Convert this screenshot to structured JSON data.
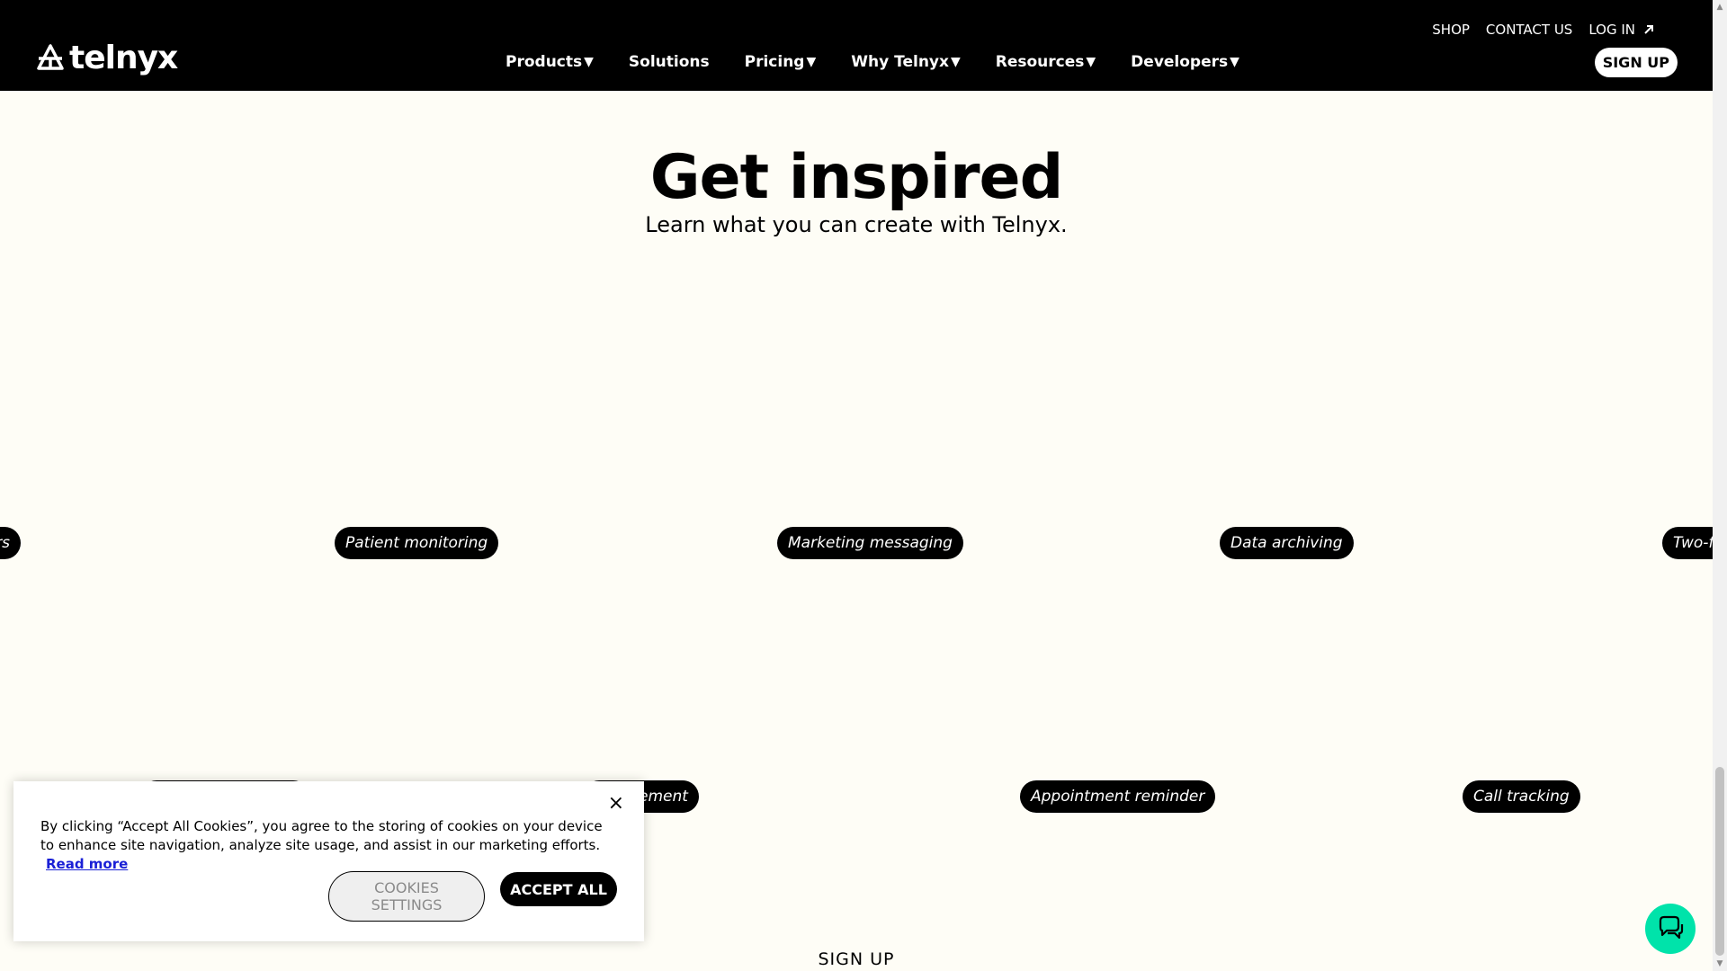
{
  "header": {
    "logo_text": "telnyx",
    "top_links": {
      "shop": "SHOP",
      "contact": "CONTACT US",
      "login": "LOG IN"
    },
    "nav": [
      {
        "label": "Products",
        "has_dropdown": true
      },
      {
        "label": "Solutions",
        "has_dropdown": false
      },
      {
        "label": "Pricing",
        "has_dropdown": true
      },
      {
        "label": "Why Telnyx",
        "has_dropdown": true
      },
      {
        "label": "Resources",
        "has_dropdown": true
      },
      {
        "label": "Developers",
        "has_dropdown": true
      }
    ],
    "dropdown_glyph": "▼",
    "signup": "SIGN UP"
  },
  "hero": {
    "title": "Get inspired",
    "subtitle": "Learn what you can create with Telnyx."
  },
  "use_cases_row1": [
    "rs",
    "Patient monitoring",
    "Marketing messaging",
    "Data archiving",
    "Two-f"
  ],
  "use_cases_row2": [
    "",
    "nagement",
    "Appointment reminder",
    "Call tracking"
  ],
  "cookie_banner": {
    "text": "By clicking “Accept All Cookies”, you agree to the storing of cookies on your device to enhance site navigation, analyze site usage, and assist in our marketing efforts.",
    "read_more": "Read more",
    "settings": "COOKIES SETTINGS",
    "accept": "ACCEPT ALL",
    "close": "×"
  },
  "bottom": {
    "signup": "SIGN UP"
  },
  "colors": {
    "header_bg": "#000000",
    "page_bg": "#fefdf6",
    "chat_accent": "#00e3aa",
    "link": "#1a20d6"
  }
}
